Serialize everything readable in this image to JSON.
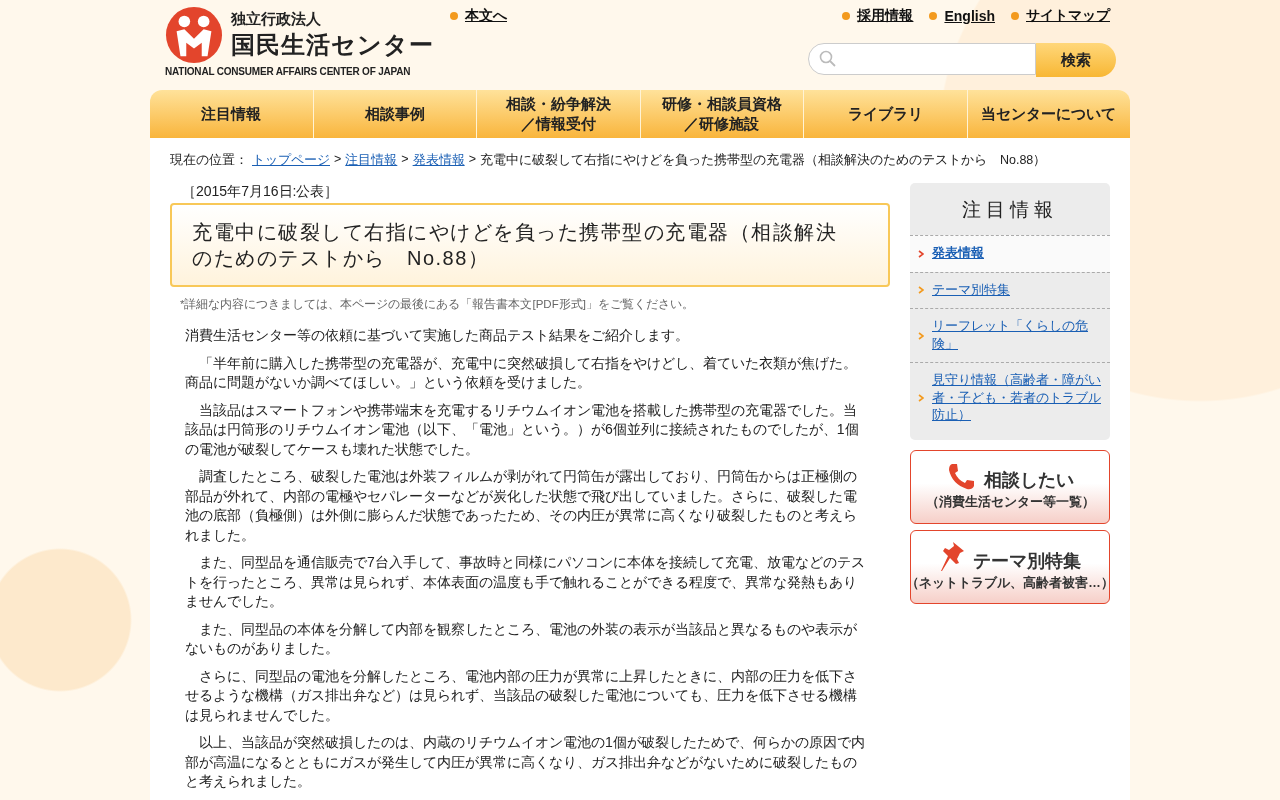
{
  "header": {
    "logo": {
      "org_type": "独立行政法人",
      "name": "国民生活センター",
      "english": "NATIONAL CONSUMER AFFAIRS CENTER OF JAPAN"
    },
    "skip_link": "本文へ",
    "utility_links": [
      "採用情報",
      "English",
      "サイトマップ"
    ],
    "search": {
      "button": "検索"
    }
  },
  "nav": [
    {
      "lines": [
        "注目情報"
      ]
    },
    {
      "lines": [
        "相談事例"
      ]
    },
    {
      "lines": [
        "相談・紛争解決",
        "／情報受付"
      ]
    },
    {
      "lines": [
        "研修・相談員資格",
        "／研修施設"
      ]
    },
    {
      "lines": [
        "ライブラリ"
      ]
    },
    {
      "lines": [
        "当センターについて"
      ]
    }
  ],
  "breadcrumb": {
    "prefix": "現在の位置：",
    "links": [
      "トップページ",
      "注目情報",
      "発表情報"
    ],
    "separator": ">",
    "current": "充電中に破裂して右指にやけどを負った携帯型の充電器（相談解決のためのテストから　No.88）"
  },
  "article": {
    "date": "［2015年7月16日:公表］",
    "title": "充電中に破裂して右指にやけどを負った携帯型の充電器（相談解決のためのテストから　No.88）",
    "note": "*詳細な内容につきましては、本ページの最後にある「報告書本文[PDF形式]」をご覧ください。",
    "paragraphs": [
      {
        "indent": false,
        "text": "消費生活センター等の依頼に基づいて実施した商品テスト結果をご紹介します。"
      },
      {
        "indent": true,
        "text": "「半年前に購入した携帯型の充電器が、充電中に突然破損して右指をやけどし、着ていた衣類が焦げた。商品に問題がないか調べてほしい。」という依頼を受けました。"
      },
      {
        "indent": true,
        "text": "当該品はスマートフォンや携帯端末を充電するリチウムイオン電池を搭載した携帯型の充電器でした。当該品は円筒形のリチウムイオン電池（以下、「電池」という。）が6個並列に接続されたものでしたが、1個の電池が破裂してケースも壊れた状態でした。"
      },
      {
        "indent": true,
        "text": "調査したところ、破裂した電池は外装フィルムが剥がれて円筒缶が露出しており、円筒缶からは正極側の部品が外れて、内部の電極やセパレーターなどが炭化した状態で飛び出していました。さらに、破裂した電池の底部（負極側）は外側に膨らんだ状態であったため、その内圧が異常に高くなり破裂したものと考えられました。"
      },
      {
        "indent": true,
        "text": "また、同型品を通信販売で7台入手して、事故時と同様にパソコンに本体を接続して充電、放電などのテストを行ったところ、異常は見られず、本体表面の温度も手で触れることができる程度で、異常な発熱もありませんでした。"
      },
      {
        "indent": true,
        "text": "また、同型品の本体を分解して内部を観察したところ、電池の外装の表示が当該品と異なるものや表示がないものがありました。"
      },
      {
        "indent": true,
        "text": "さらに、同型品の電池を分解したところ、電池内部の圧力が異常に上昇したときに、内部の圧力を低下させるような機構（ガス排出弁など）は見られず、当該品の破裂した電池についても、圧力を低下させる機構は見られませんでした。"
      },
      {
        "indent": true,
        "text": "以上、当該品が突然破損したのは、内蔵のリチウムイオン電池の1個が破裂したためで、何らかの原因で内部が高温になるとともにガスが発生して内圧が異常に高くなり、ガス排出弁などがないために破裂したものと考えられました。"
      }
    ]
  },
  "sidebar": {
    "heading": "注目情報",
    "items": [
      {
        "label": "発表情報",
        "selected": true
      },
      {
        "label": "テーマ別特集",
        "selected": false
      },
      {
        "label": "リーフレット「くらしの危険」",
        "selected": false
      },
      {
        "label": "見守り情報（高齢者・障がい者・子ども・若者のトラブル防止）",
        "selected": false
      }
    ],
    "banners": [
      {
        "kind": "phone",
        "title": "相談したい",
        "subtitle": "（消費生活センター等一覧）"
      },
      {
        "kind": "pin",
        "title": "テーマ別特集",
        "subtitle": "（ネットトラブル、高齢者被害…）"
      }
    ]
  }
}
